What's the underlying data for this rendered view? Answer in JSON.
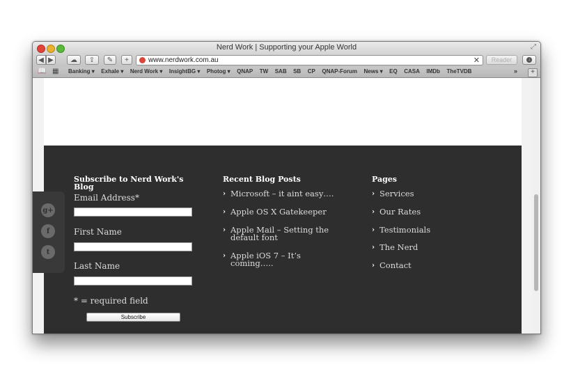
{
  "window": {
    "title": "Nerd Work | Supporting your Apple World"
  },
  "toolbar": {
    "url": "www.nerdwork.com.au",
    "reader_label": "Reader",
    "clear": "✕"
  },
  "bookmarks": {
    "items": [
      "Banking ▾",
      "Exhale ▾",
      "Nerd Work ▾",
      "InsightBG ▾",
      "Photog ▾",
      "QNAP",
      "TW",
      "SAB",
      "SB",
      "CP",
      "QNAP-Forum",
      "News ▾",
      "EQ",
      "CASA",
      "IMDb",
      "TheTVDB"
    ],
    "more": "»",
    "add": "+"
  },
  "social": {
    "items": [
      "g+",
      "f",
      "t"
    ]
  },
  "subscribe": {
    "heading": "Subscribe to Nerd Work's Blog",
    "email_label": "Email Address*",
    "first_name_label": "First Name",
    "last_name_label": "Last Name",
    "required_note": "* = required field",
    "button": "Subscribe"
  },
  "recent_posts": {
    "heading": "Recent Blog Posts",
    "items": [
      "Microsoft – it aint easy….",
      "Apple OS X Gatekeeper",
      "Apple Mail – Setting the default font",
      "Apple iOS 7 – It’s coming….."
    ]
  },
  "pages": {
    "heading": "Pages",
    "items": [
      "Services",
      "Our Rates",
      "Testimonials",
      "The Nerd",
      "Contact"
    ]
  }
}
